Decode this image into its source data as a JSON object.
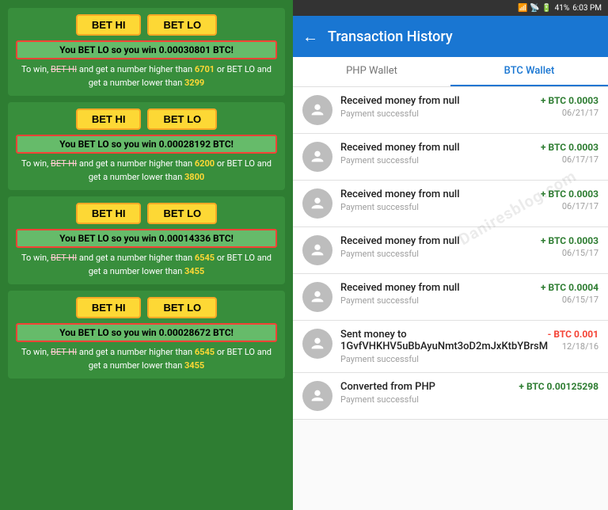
{
  "left": {
    "cards": [
      {
        "winMessage": "You BET LO so you win 0.00030801 BTC!",
        "description1": "To win, BET HI and get a number higher than",
        "highlight1": "6701",
        "description2": "or BET LO and get a number lower than",
        "highlight2": "3299",
        "strikethrough": "BET HI"
      },
      {
        "winMessage": "You BET LO so you win 0.00028192 BTC!",
        "description1": "To win, BET HI and get a number higher than",
        "highlight1": "6200",
        "description2": "or BET LO and get a number lower than",
        "highlight2": "3800",
        "strikethrough": "BET HI"
      },
      {
        "winMessage": "You BET LO so you win 0.00014336 BTC!",
        "description1": "To win, BET HI and get a number higher than",
        "highlight1": "6545",
        "description2": "or BET LO and get a number lower than",
        "highlight2": "3455",
        "strikethrough": "BET HI"
      },
      {
        "winMessage": "You BET LO so you win 0.00028672 BTC!",
        "description1": "To win, BET HI and get a number higher than",
        "highlight1": "6545",
        "description2": "or BET LO and get a number lower than",
        "highlight2": "3455",
        "strikethrough": "BET HI"
      }
    ],
    "btnHi": "BET HI",
    "btnLo": "BET LO"
  },
  "right": {
    "statusBar": {
      "time": "6:03 PM",
      "battery": "41%"
    },
    "header": {
      "backLabel": "←",
      "title": "Transaction History"
    },
    "tabs": [
      {
        "label": "PHP Wallet",
        "active": false
      },
      {
        "label": "BTC Wallet",
        "active": true
      }
    ],
    "transactions": [
      {
        "title": "Received money from null",
        "status": "Payment successful",
        "amount": "+ BTC 0.0003",
        "amountType": "positive",
        "date": "06/21/17"
      },
      {
        "title": "Received money from null",
        "status": "Payment successful",
        "amount": "+ BTC 0.0003",
        "amountType": "positive",
        "date": "06/17/17"
      },
      {
        "title": "Received money from null",
        "status": "Payment successful",
        "amount": "+ BTC 0.0003",
        "amountType": "positive",
        "date": "06/17/17"
      },
      {
        "title": "Received money from null",
        "status": "Payment successful",
        "amount": "+ BTC 0.0003",
        "amountType": "positive",
        "date": "06/15/17"
      },
      {
        "title": "Received money from null",
        "status": "Payment successful",
        "amount": "+ BTC 0.0004",
        "amountType": "positive",
        "date": "06/15/17"
      },
      {
        "title": "Sent money to 1GvfVHKHV5uBbAyuNmt3oD2mJxKtbYBrsM",
        "status": "Payment successful",
        "amount": "- BTC 0.001",
        "amountType": "negative",
        "date": "12/18/16"
      },
      {
        "title": "Converted from PHP",
        "status": "Payment successful",
        "amount": "+ BTC 0.00125298",
        "amountType": "positive",
        "date": ""
      }
    ]
  }
}
